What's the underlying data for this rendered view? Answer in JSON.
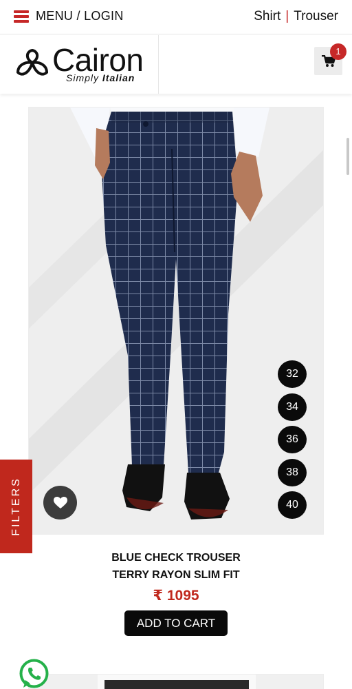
{
  "header": {
    "menu_label": "MENU / LOGIN",
    "categories": [
      "Shirt",
      "Trouser"
    ],
    "separator": "|",
    "accent_color": "#c62828"
  },
  "brand": {
    "name": "Cairon",
    "tagline_light": "Simply",
    "tagline_bold": "Italian"
  },
  "cart": {
    "icon": "shopping-cart-icon",
    "count": "1"
  },
  "product": {
    "name_line1": "BLUE CHECK TROUSER",
    "name_line2": "TERRY RAYON SLIM FIT",
    "price": "₹ 1095",
    "add_to_cart": "ADD TO CART",
    "sizes": [
      "32",
      "34",
      "36",
      "38",
      "40"
    ]
  },
  "filters_label": "FILTERS",
  "icons": {
    "wishlist": "heart-icon",
    "chat": "whatsapp-icon"
  }
}
